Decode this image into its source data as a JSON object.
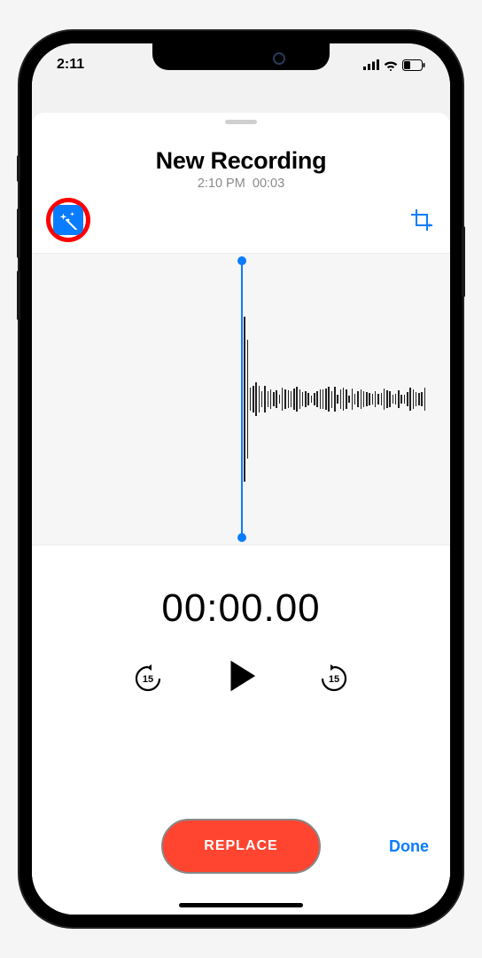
{
  "status": {
    "time": "2:11"
  },
  "recording": {
    "title": "New Recording",
    "timestamp": "2:10 PM",
    "duration": "00:03"
  },
  "playback": {
    "position": "00:00.00",
    "skip_seconds": "15"
  },
  "actions": {
    "replace_label": "REPLACE",
    "done_label": "Done"
  },
  "colors": {
    "accent": "#0a7cff",
    "replace": "#ff4530",
    "highlight_ring": "#ff0000"
  }
}
